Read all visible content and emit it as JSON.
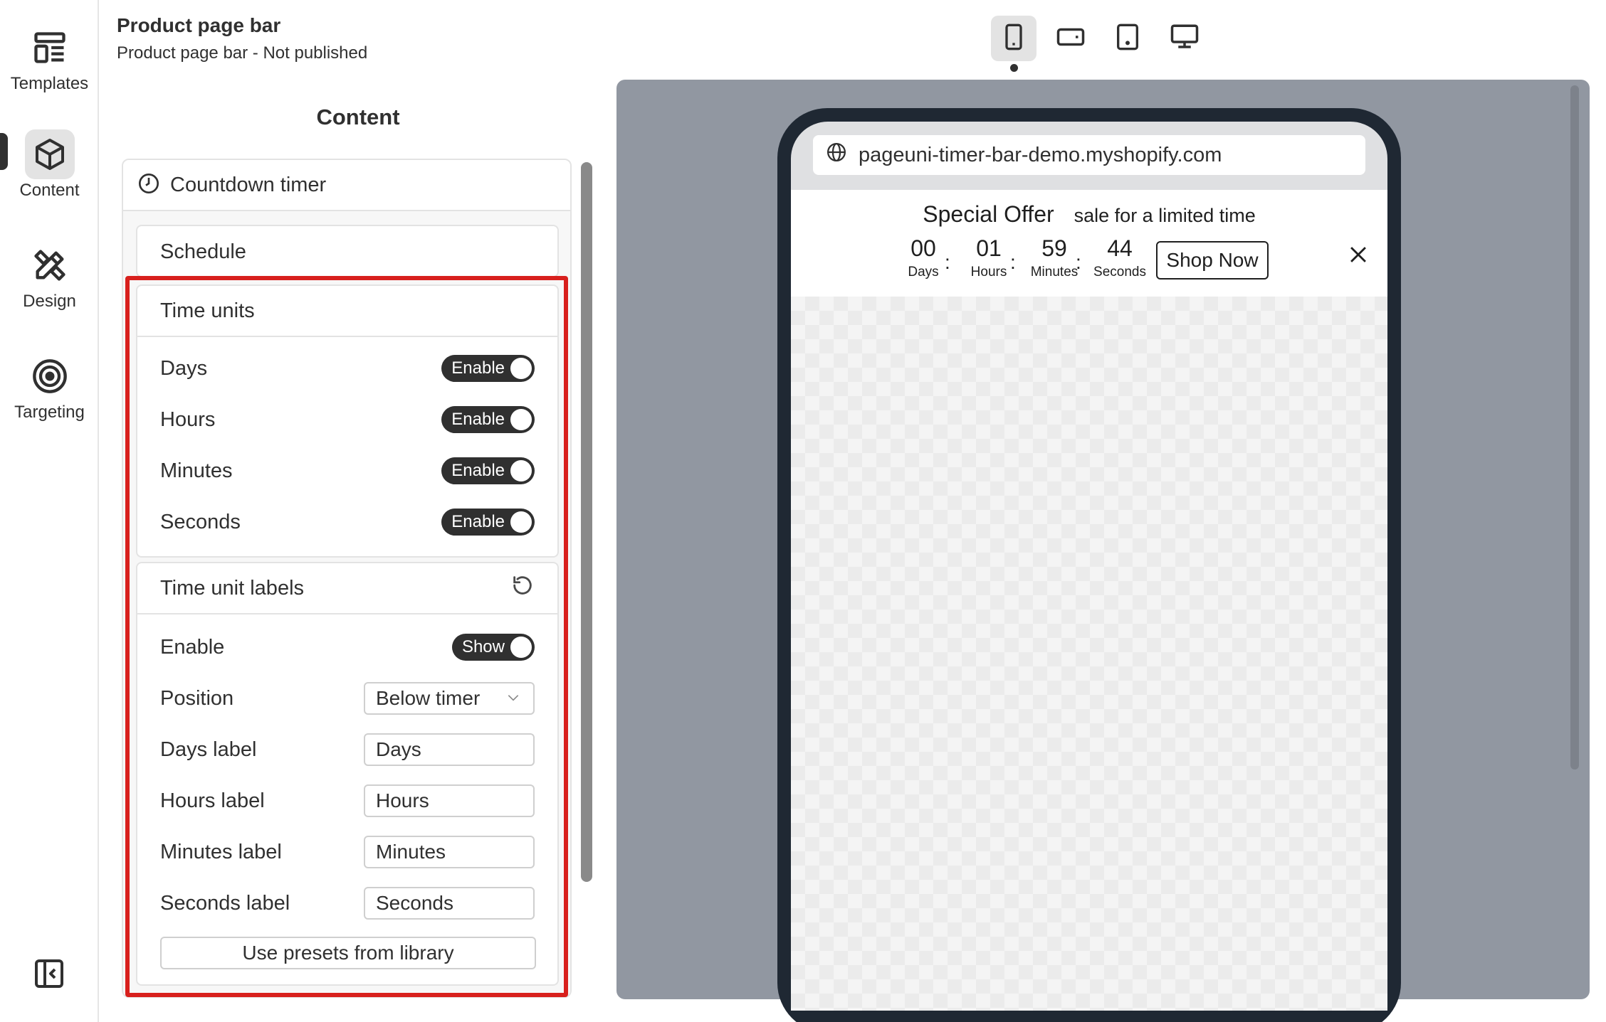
{
  "nav": {
    "items": [
      {
        "label": "Templates",
        "icon": "templates-icon"
      },
      {
        "label": "Content",
        "icon": "cube-icon",
        "active": true
      },
      {
        "label": "Design",
        "icon": "design-tools-icon"
      },
      {
        "label": "Targeting",
        "icon": "target-icon"
      }
    ],
    "collapse_icon": "sidebar-collapse-icon"
  },
  "header": {
    "title": "Product page bar",
    "subtitle": "Product page bar - Not published"
  },
  "panel": {
    "heading": "Content",
    "section_title": "Countdown timer",
    "schedule_label": "Schedule",
    "time_units": {
      "title": "Time units",
      "rows": [
        {
          "label": "Days",
          "toggle": "Enable"
        },
        {
          "label": "Hours",
          "toggle": "Enable"
        },
        {
          "label": "Minutes",
          "toggle": "Enable"
        },
        {
          "label": "Seconds",
          "toggle": "Enable"
        }
      ]
    },
    "time_unit_labels": {
      "title": "Time unit labels",
      "reset_icon": "reset-icon",
      "enable": {
        "label": "Enable",
        "toggle": "Show"
      },
      "position": {
        "label": "Position",
        "value": "Below timer"
      },
      "days_label": {
        "label": "Days label",
        "value": "Days"
      },
      "hours_label": {
        "label": "Hours label",
        "value": "Hours"
      },
      "minutes_label": {
        "label": "Minutes label",
        "value": "Minutes"
      },
      "seconds_label": {
        "label": "Seconds label",
        "value": "Seconds"
      },
      "presets_button": "Use presets from library"
    }
  },
  "devices": [
    {
      "name": "mobile",
      "icon": "mobile-icon",
      "active": true
    },
    {
      "name": "mobile-landscape",
      "icon": "mobile-landscape-icon"
    },
    {
      "name": "tablet",
      "icon": "tablet-icon"
    },
    {
      "name": "desktop",
      "icon": "desktop-icon"
    }
  ],
  "preview": {
    "url": "pageuni-timer-bar-demo.myshopify.com",
    "offer_title": "Special Offer",
    "offer_text": "sale for a limited time",
    "timer": [
      {
        "value": "00",
        "label": "Days"
      },
      {
        "value": "01",
        "label": "Hours"
      },
      {
        "value": "59",
        "label": "Minutes"
      },
      {
        "value": "44",
        "label": "Seconds"
      }
    ],
    "separator": ":",
    "button": "Shop Now"
  },
  "colors": {
    "highlight": "#d8201d",
    "toggle_bg": "#303030",
    "preview_bg": "#9197a1",
    "phone_frame": "#1f2833"
  }
}
